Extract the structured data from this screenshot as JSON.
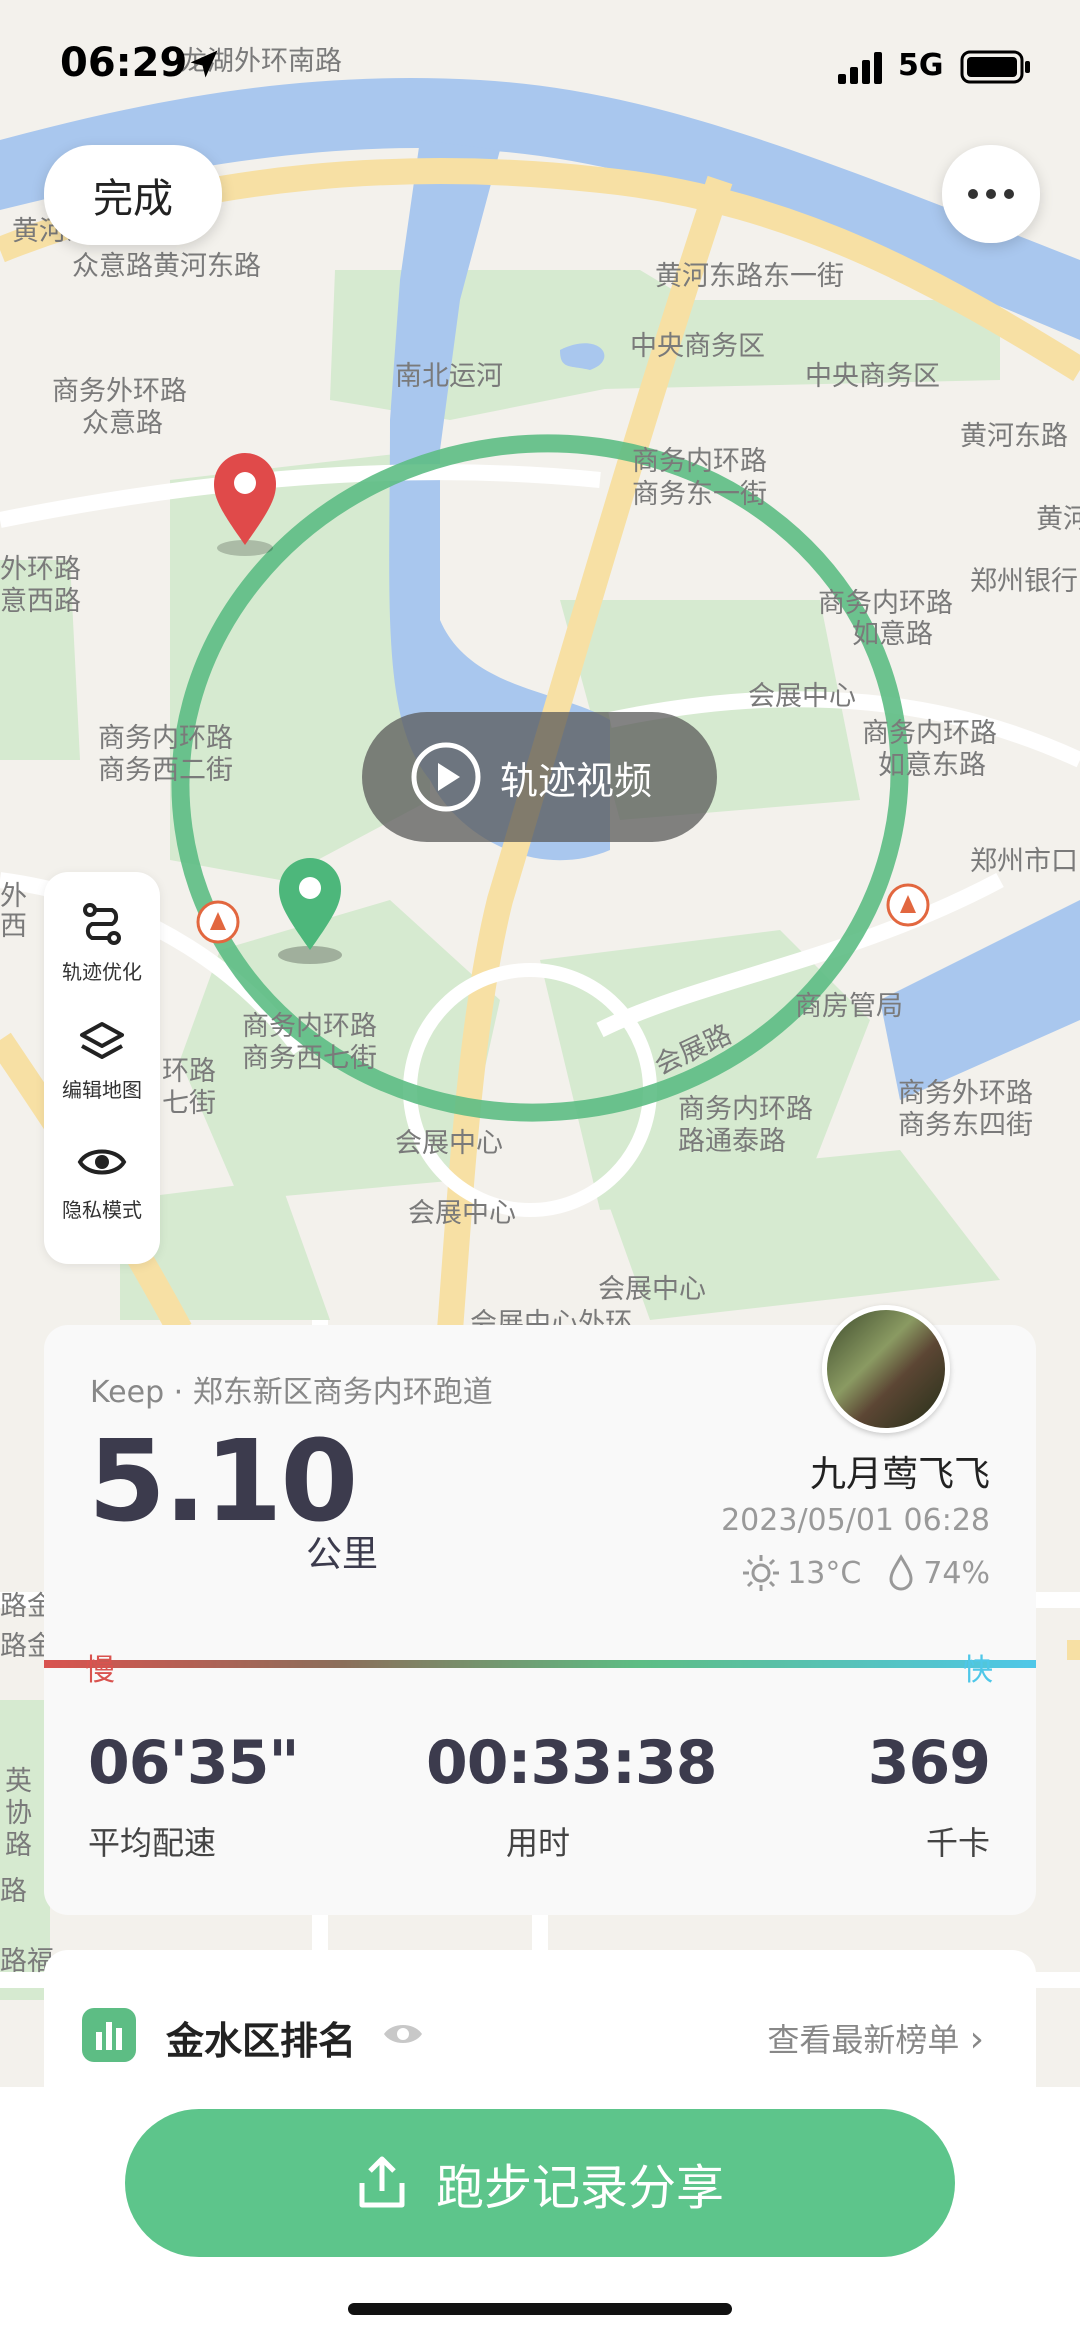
{
  "status_bar": {
    "time": "06:29",
    "network": "5G"
  },
  "header": {
    "done_label": "完成"
  },
  "map": {
    "labels": [
      "龙湖外环南路",
      "黄河东路",
      "众意路黄河东路",
      "黄河东路东一街",
      "中央商务区",
      "中央商务区",
      "黄河东路",
      "南北运河",
      "商务外环路",
      "众意路",
      "商务内环路",
      "商务东一街",
      "黄河",
      "外环路",
      "意西路",
      "郑州银行",
      "商务内环路",
      "如意路",
      "会展中心",
      "商务内环路",
      "商务西二街",
      "商务内环路",
      "如意东路",
      "郑州市口",
      "外",
      "西",
      "商务内环路",
      "商务西七街",
      "环路",
      "七街",
      "会展路",
      "商房管局",
      "商务内环路",
      "路通泰路",
      "商务外环路",
      "商务东四街",
      "会展中心",
      "会展中心",
      "会展中心",
      "会展中心外环",
      "英",
      "协",
      "路",
      "路金",
      "路金",
      "路",
      "路福"
    ],
    "route_color": "#5dbd84"
  },
  "play_button": {
    "label": "轨迹视频"
  },
  "tools": [
    {
      "label": "轨迹优化",
      "icon": "route-icon"
    },
    {
      "label": "编辑地图",
      "icon": "layers-icon"
    },
    {
      "label": "隐私模式",
      "icon": "eye-icon"
    }
  ],
  "summary": {
    "route_name": "Keep · 郑东新区商务内环跑道",
    "distance": "5.10",
    "distance_unit": "公里",
    "user_name": "九月莺飞飞",
    "datetime": "2023/05/01 06:28",
    "temperature": "13°C",
    "humidity": "74%",
    "slow_label": "慢",
    "fast_label": "快",
    "stats": [
      {
        "value": "06'35\"",
        "label": "平均配速"
      },
      {
        "value": "00:33:38",
        "label": "用时"
      },
      {
        "value": "369",
        "label": "千卡"
      }
    ]
  },
  "ranking": {
    "title": "金水区排名",
    "link": "查看最新榜单"
  },
  "share_button": {
    "label": "跑步记录分享"
  }
}
